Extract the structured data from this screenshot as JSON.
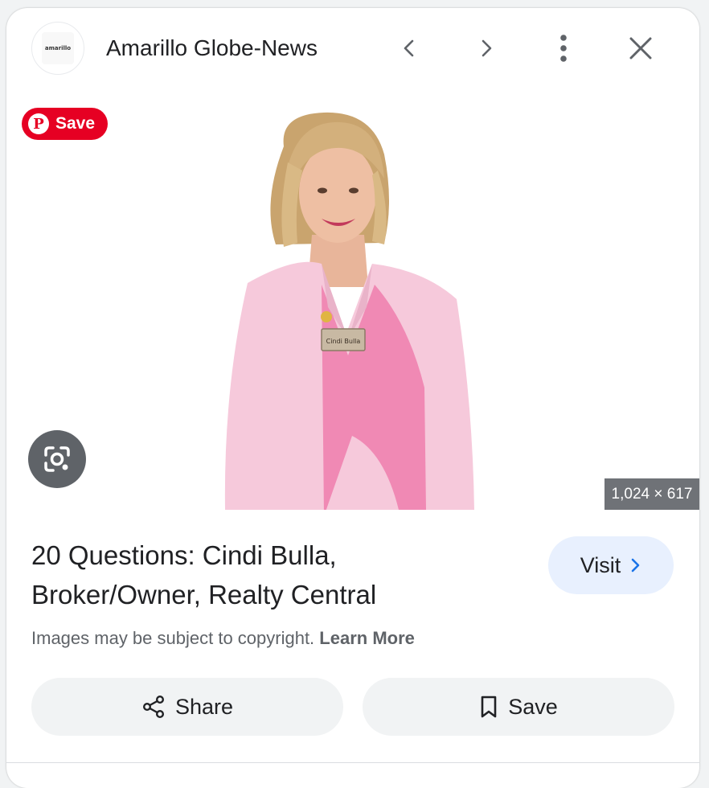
{
  "header": {
    "logo_text": "amarillo",
    "source_name": "Amarillo Globe-News"
  },
  "image": {
    "pinterest_save_label": "Save",
    "dimensions": "1,024 × 617",
    "badge_text": "Cindi Bulla"
  },
  "result": {
    "title": "20 Questions: Cindi Bulla, Broker/Owner, Realty Central",
    "visit_label": "Visit",
    "copyright_text": "Images may be subject to copyright.",
    "learn_more_label": "Learn More"
  },
  "actions": {
    "share_label": "Share",
    "save_label": "Save"
  },
  "colors": {
    "pinterest_red": "#e60023",
    "visit_bg": "#e8f0fe",
    "link_blue": "#1a73e8",
    "jacket_pink": "#f6c9db",
    "top_pink": "#f089b4"
  }
}
